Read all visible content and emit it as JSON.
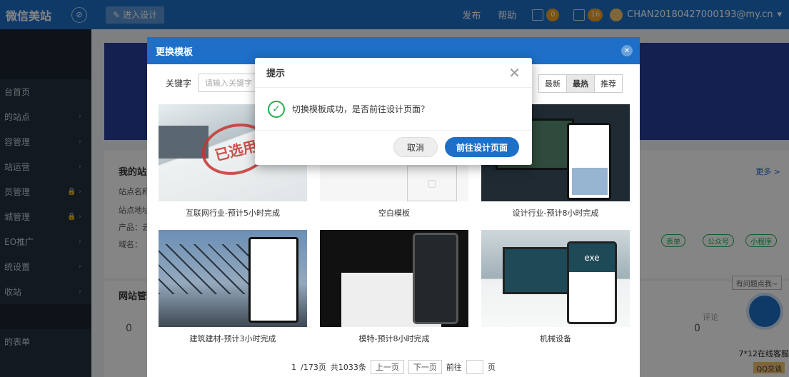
{
  "topbar": {
    "brand": "微信美站",
    "enter_design": "进入设计",
    "publish": "发布",
    "help": "帮助",
    "messages_count": "0",
    "notifications_count": "16",
    "user": "CHAN20180427000193@my.cn"
  },
  "sidebar": {
    "items": [
      {
        "label": "台首页"
      },
      {
        "label": "的站点"
      },
      {
        "label": "容管理"
      },
      {
        "label": "站运营"
      },
      {
        "label": "员管理"
      },
      {
        "label": "城管理"
      },
      {
        "label": "EO推广"
      },
      {
        "label": "统设置"
      },
      {
        "label": "收站"
      },
      {
        "label": "的表单"
      }
    ]
  },
  "page": {
    "my_site_title": "我的站点",
    "site_name_label": "站点名称",
    "site_address_label": "站点地址",
    "product_label": "产品：云",
    "domain_label": "域名：",
    "more": "更多 >",
    "pills": [
      "表单",
      "公众号",
      "小程序"
    ],
    "stats_title": "网站管理",
    "stat_left": "0",
    "stat_right": "0",
    "stat_right_label": "评论",
    "chat_prompt": "有问题点我~",
    "service_text": "7*12在线客服",
    "qq_label": "QQ交谈"
  },
  "template_modal": {
    "title": "更换模板",
    "keyword_label": "关键字",
    "keyword_placeholder": "请输入关键字",
    "sort": [
      "最新",
      "最热",
      "推荐"
    ],
    "templates": [
      {
        "name": "互联网行业-预计5小时完成",
        "stamp": "已选用"
      },
      {
        "name": "空白模板"
      },
      {
        "name": "设计行业-预计8小时完成"
      },
      {
        "name": "建筑建材-预计3小时完成"
      },
      {
        "name": "模特-预计8小时完成"
      },
      {
        "name": "机械设备"
      }
    ],
    "pager": {
      "page": "1",
      "total_pages": "/173页",
      "total": "共1033条",
      "prev": "上一页",
      "next": "下一页",
      "goto": "前往",
      "page_unit": "页"
    }
  },
  "dialog": {
    "title": "提示",
    "message": "切换模板成功，是否前往设计页面？",
    "cancel": "取消",
    "confirm": "前往设计页面"
  },
  "colors": {
    "primary": "#1d6fc7",
    "success": "#24b04b",
    "sidebar": "#24303e"
  }
}
